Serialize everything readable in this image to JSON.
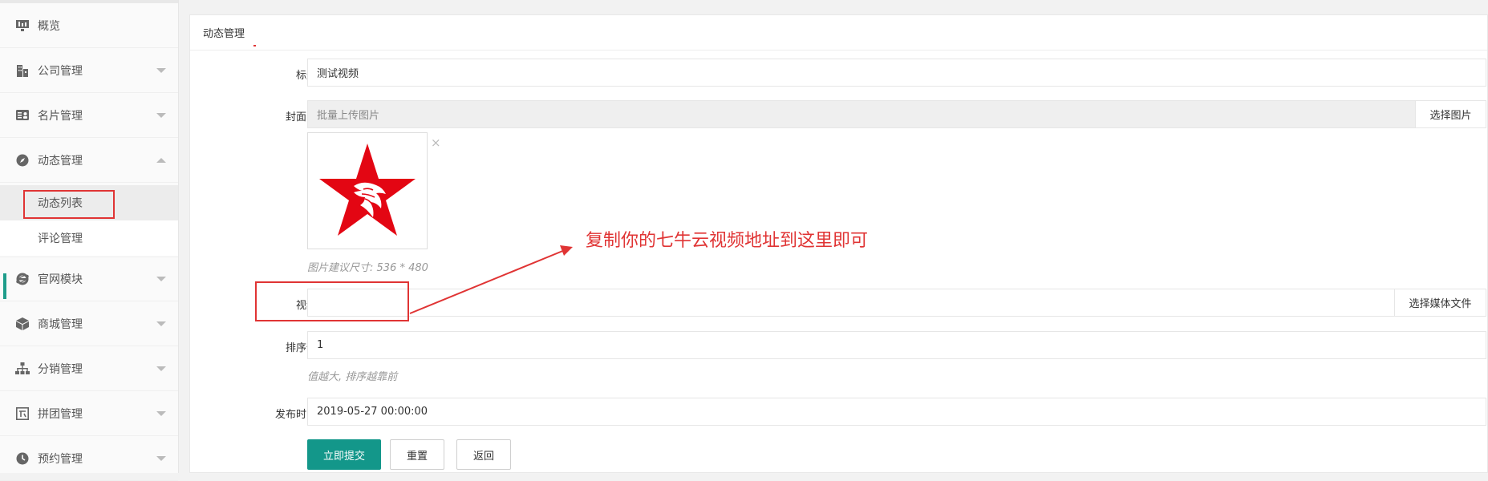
{
  "sidebar": {
    "items": [
      {
        "label": "概览",
        "icon": "monitor-icon"
      },
      {
        "label": "公司管理",
        "icon": "building-icon"
      },
      {
        "label": "名片管理",
        "icon": "id-card-icon"
      },
      {
        "label": "动态管理",
        "icon": "compass-icon"
      },
      {
        "label": "官网模块",
        "icon": "ie-browser-icon"
      },
      {
        "label": "商城管理",
        "icon": "box-icon"
      },
      {
        "label": "分销管理",
        "icon": "org-chart-icon"
      },
      {
        "label": "拼团管理",
        "icon": "pin-square-icon"
      },
      {
        "label": "预约管理",
        "icon": "clock-icon"
      }
    ],
    "subitems": [
      {
        "label": "动态列表"
      },
      {
        "label": "评论管理"
      }
    ]
  },
  "tab": {
    "label": "动态管理"
  },
  "form": {
    "title_label": "标题",
    "title_value": "测试视频",
    "cover_label": "封面图",
    "cover_placeholder": "批量上传图片",
    "cover_button": "选择图片",
    "cover_close": "×",
    "cover_hint": "图片建议尺寸: 536 * 480",
    "video_label": "视频",
    "video_value": "",
    "video_button": "选择媒体文件",
    "sort_label": "排序值",
    "sort_value": "1",
    "sort_hint": "值越大, 排序越靠前",
    "time_label": "发布时间",
    "time_value": "2019-05-27 00:00:00"
  },
  "buttons": {
    "submit": "立即提交",
    "reset": "重置",
    "back": "返回"
  },
  "annotation": {
    "text": "复制你的七牛云视频地址到这里即可"
  },
  "colors": {
    "primary": "#13978a",
    "annotation_red": "#e03434",
    "star_red": "#e30613"
  }
}
